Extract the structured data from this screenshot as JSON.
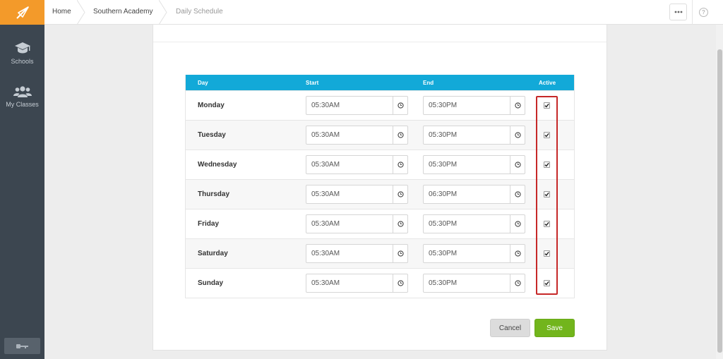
{
  "nav": {
    "items": [
      {
        "label": "Schools",
        "icon": "graduation-cap-icon"
      },
      {
        "label": "My Classes",
        "icon": "users-icon"
      }
    ]
  },
  "breadcrumb": [
    "Home",
    "Southern Academy",
    "Daily Schedule"
  ],
  "help_label": "?",
  "table": {
    "headers": {
      "day": "Day",
      "start": "Start",
      "end": "End",
      "active": "Active"
    },
    "rows": [
      {
        "day": "Monday",
        "start": "05:30AM",
        "end": "05:30PM",
        "active": true
      },
      {
        "day": "Tuesday",
        "start": "05:30AM",
        "end": "05:30PM",
        "active": true
      },
      {
        "day": "Wednesday",
        "start": "05:30AM",
        "end": "05:30PM",
        "active": true
      },
      {
        "day": "Thursday",
        "start": "05:30AM",
        "end": "06:30PM",
        "active": true
      },
      {
        "day": "Friday",
        "start": "05:30AM",
        "end": "05:30PM",
        "active": true
      },
      {
        "day": "Saturday",
        "start": "05:30AM",
        "end": "05:30PM",
        "active": true
      },
      {
        "day": "Sunday",
        "start": "05:30AM",
        "end": "05:30PM",
        "active": true
      }
    ]
  },
  "actions": {
    "cancel": "Cancel",
    "save": "Save"
  },
  "colors": {
    "brand": "#f39a2a",
    "sidebar": "#3c4650",
    "table_header": "#12a9d8",
    "save": "#72b51c",
    "highlight": "#c62828"
  }
}
